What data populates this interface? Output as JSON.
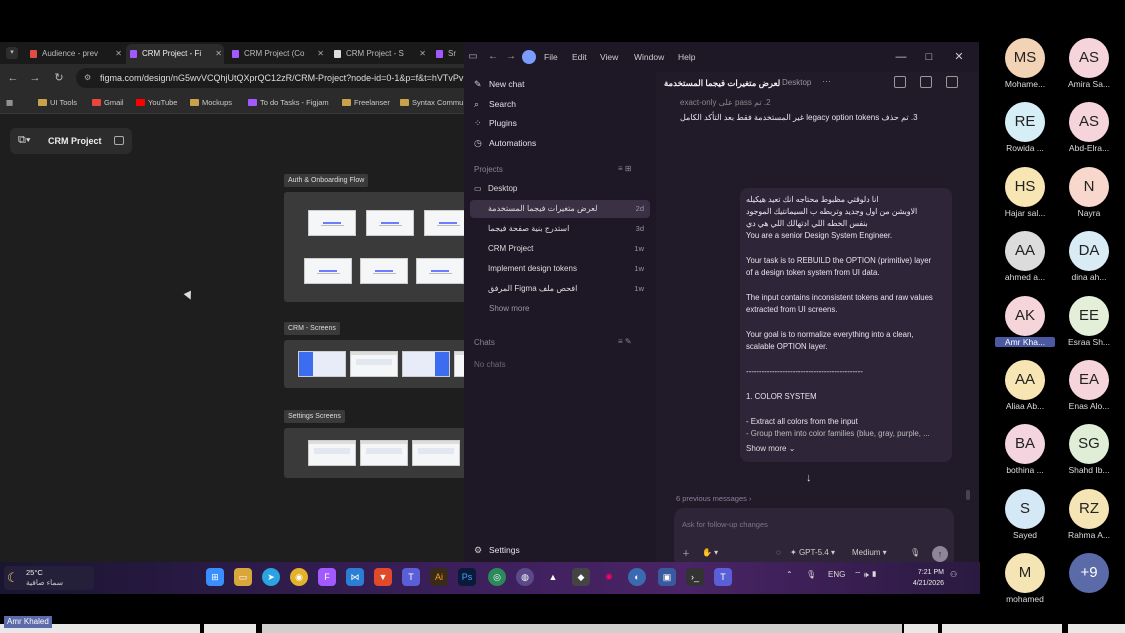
{
  "browser": {
    "tabs": [
      "Audience - prev",
      "CRM Project - Fi",
      "CRM Project (Co",
      "CRM Project - S",
      "Sr"
    ],
    "url": "figma.com/design/nG5wvVCQhjUtQXprQC12zR/CRM-Project?node-id=0-1&p=f&t=hVTvPv",
    "bookmarks": [
      "UI Tools",
      "Gmail",
      "YouTube",
      "Mockups",
      "To do Tasks - Figjam",
      "Freelanser",
      "Syntax Commu"
    ]
  },
  "figma": {
    "file_name": "CRM Project",
    "sections": [
      "Auth & Onboarding Flow",
      "CRM - Screens",
      "Settings Screens"
    ]
  },
  "app": {
    "menu": [
      "File",
      "Edit",
      "View",
      "Window",
      "Help"
    ],
    "sidebar": {
      "nav": [
        "New chat",
        "Search",
        "Plugins",
        "Automations"
      ],
      "projects_label": "Projects",
      "folder": "Desktop",
      "threads": [
        {
          "name": "لعرض متغيرات فيجما المستخدمة",
          "time": "2d"
        },
        {
          "name": "استدرج بنية صفحة فيجما",
          "time": "3d"
        },
        {
          "name": "CRM Project",
          "time": "1w"
        },
        {
          "name": "Implement design tokens",
          "time": "1w"
        },
        {
          "name": "افحص ملف Figma المرفق",
          "time": "1w"
        }
      ],
      "show_more": "Show more",
      "chats_label": "Chats",
      "no_chats": "No chats",
      "settings": "Settings"
    },
    "thread": {
      "title": "لعرض متغيرات فيجما المستخدمة",
      "location": "Desktop",
      "top_line_1": "2. تم pass على exact-only",
      "top_line_2": "3. تم حذف legacy option tokens غير المستخدمة فقط بعد التأكد الكامل",
      "bubble_lines": [
        "انا دلوقتي مظبوط محتاجه انك تعيد هيكيله",
        "الاوبشن من اول وجديد وتربطه ب السيمانتيك الموجود",
        "بنفس الخطه اللي ادتهالك اللي هي دي",
        "You are a senior Design System Engineer.",
        "",
        "Your task is to REBUILD the OPTION (primitive) layer",
        "of a design token system from UI data.",
        "",
        "The input contains inconsistent tokens and raw values",
        "extracted from UI screens.",
        "",
        "Your goal is to normalize everything into a clean,",
        "scalable OPTION layer.",
        "",
        "---------------------------------------------",
        "",
        "1. COLOR SYSTEM",
        "",
        "- Extract all colors from the input",
        "- Group them into color families (blue, gray, purple, ..."
      ],
      "show_more": "Show more",
      "previous_messages": "6 previous messages",
      "composer_placeholder": "Ask for follow-up changes",
      "model": "GPT-5.4",
      "reasoning": "Medium"
    }
  },
  "taskbar": {
    "temperature": "25°C",
    "condition": "سماء صافية",
    "lang": "ENG",
    "time": "7:21 PM",
    "date": "4/21/2026"
  },
  "presenter_name": "Amr Khaled",
  "participants": [
    {
      "initials": "MS",
      "name": "Mohame...",
      "color": "#f3d3b6"
    },
    {
      "initials": "AS",
      "name": "Amira Sa...",
      "color": "#f6d4dc"
    },
    {
      "initials": "RE",
      "name": "Rowida ...",
      "color": "#d6eef6"
    },
    {
      "initials": "AS",
      "name": "Abd-Elra...",
      "color": "#f6d4dc"
    },
    {
      "initials": "HS",
      "name": "Hajar sal...",
      "color": "#f7e6b4"
    },
    {
      "initials": "N",
      "name": "Nayra",
      "color": "#f8d8cc"
    },
    {
      "initials": "AA",
      "name": "ahmed a...",
      "color": "#dcdcdc"
    },
    {
      "initials": "DA",
      "name": "dina ah...",
      "color": "#d9ecf5"
    },
    {
      "initials": "AK",
      "name": "Amr Kha...",
      "color": "#f5d5d9"
    },
    {
      "initials": "EE",
      "name": "Esraa Sh...",
      "color": "#e3efd8"
    },
    {
      "initials": "AA",
      "name": "Aliaa Ab...",
      "color": "#f7e6b4"
    },
    {
      "initials": "EA",
      "name": "Enas Alo...",
      "color": "#f6d4dc"
    },
    {
      "initials": "BA",
      "name": "bothina ...",
      "color": "#f4d4de"
    },
    {
      "initials": "SG",
      "name": "Shahd Ib...",
      "color": "#e0eed8"
    },
    {
      "initials": "S",
      "name": "Sayed",
      "color": "#d5e8f5"
    },
    {
      "initials": "RZ",
      "name": "Rahma A...",
      "color": "#f5e5b4"
    },
    {
      "initials": "M",
      "name": "mohamed",
      "color": "#f5e5b4"
    },
    {
      "initials": "+9",
      "name": "",
      "color": "#5b6aa8"
    }
  ]
}
